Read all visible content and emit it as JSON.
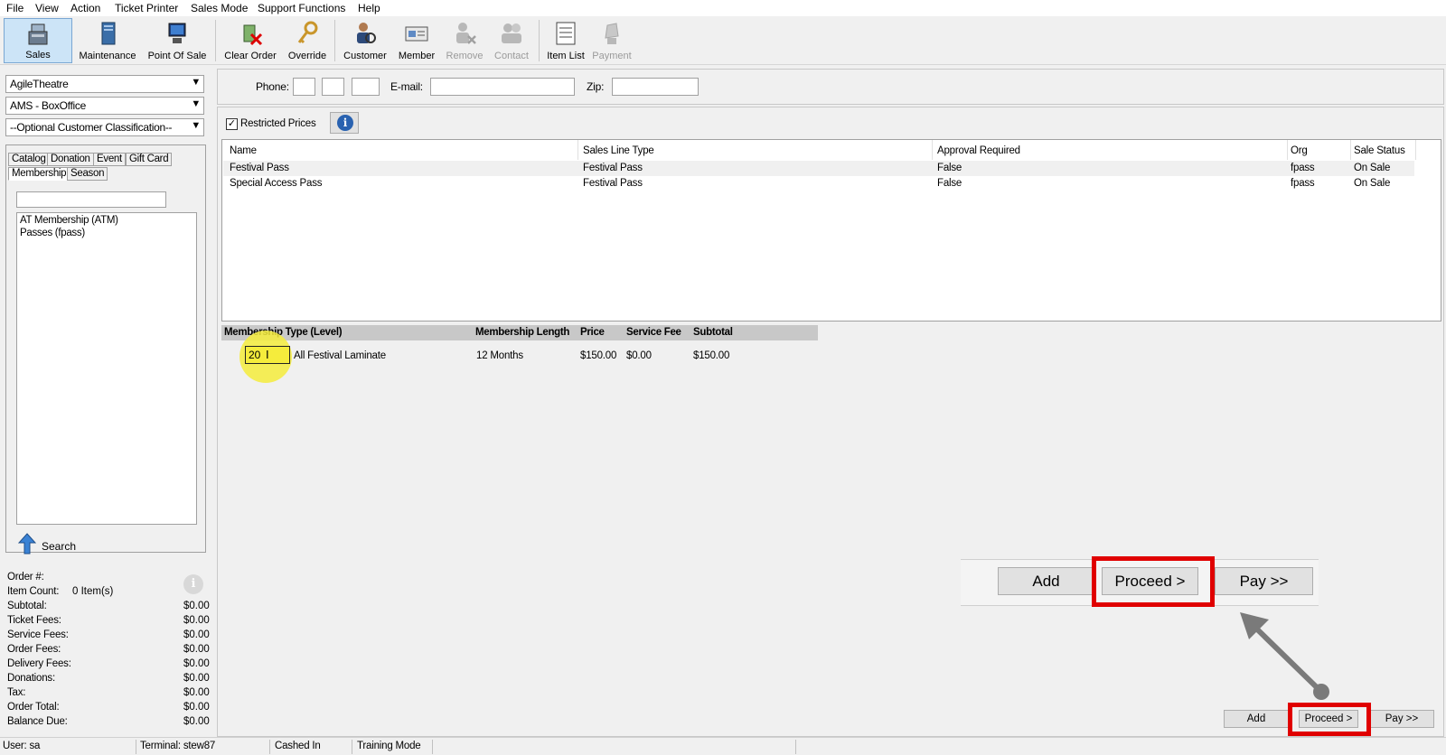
{
  "menu": [
    "File",
    "View",
    "Action",
    "Ticket Printer",
    "Sales Mode",
    "Support Functions",
    "Help"
  ],
  "toolbar": {
    "sales": "Sales",
    "maintenance": "Maintenance",
    "point_of_sale": "Point Of Sale",
    "clear_order": "Clear Order",
    "override": "Override",
    "customer": "Customer",
    "member": "Member",
    "remove": "Remove",
    "contact": "Contact",
    "item_list": "Item List",
    "payment": "Payment"
  },
  "left": {
    "organization": "AgileTheatre",
    "outlet": "AMS - BoxOffice",
    "classification": "--Optional Customer Classification--",
    "tabs": [
      "Catalog",
      "Donation",
      "Event",
      "Gift Card",
      "Membership",
      "Season"
    ],
    "catalog_items": [
      "AT Membership  (ATM)",
      "Passes  (fpass)"
    ],
    "search_label": "Search"
  },
  "summary": {
    "order_label": "Order #:",
    "item_count_label": "Item Count:",
    "item_count_value": "0 Item(s)",
    "rows": [
      {
        "label": "Subtotal:",
        "value": "$0.00"
      },
      {
        "label": "Ticket Fees:",
        "value": "$0.00"
      },
      {
        "label": "Service Fees:",
        "value": "$0.00"
      },
      {
        "label": "Order Fees:",
        "value": "$0.00"
      },
      {
        "label": "Delivery Fees:",
        "value": "$0.00"
      },
      {
        "label": "Donations:",
        "value": "$0.00"
      },
      {
        "label": "Tax:",
        "value": "$0.00"
      },
      {
        "label": "Order Total:",
        "value": "$0.00"
      },
      {
        "label": "Balance Due:",
        "value": "$0.00"
      }
    ]
  },
  "customer_bar": {
    "phone_label": "Phone:",
    "email_label": "E-mail:",
    "zip_label": "Zip:"
  },
  "restricted_prices": {
    "label": "Restricted Prices",
    "checked": true
  },
  "grid": {
    "headers": [
      "Name",
      "Sales Line Type",
      "Approval Required",
      "Org",
      "Sale Status"
    ],
    "rows": [
      [
        "Festival Pass",
        "Festival Pass",
        "False",
        "fpass",
        "On Sale"
      ],
      [
        "Special Access Pass",
        "Festival Pass",
        "False",
        "fpass",
        "On Sale"
      ]
    ]
  },
  "membership": {
    "headers": [
      "Membership Type (Level)",
      "Membership Length",
      "Price",
      "Service Fee",
      "Subtotal"
    ],
    "row": {
      "quantity": "20",
      "type": "All Festival Laminate",
      "length": "12 Months",
      "price": "$150.00",
      "service_fee": "$0.00",
      "subtotal": "$150.00"
    }
  },
  "buttons": {
    "add": "Add",
    "proceed": "Proceed >",
    "pay": "Pay >>"
  },
  "status": {
    "user": "User:  sa",
    "terminal": "Terminal: stew87",
    "cashed": "Cashed In",
    "training": "Training Mode"
  },
  "colors": {
    "highlight_red": "#e00000",
    "click_marker": "#f5ec3c",
    "selection_blue": "#cce4f7"
  }
}
